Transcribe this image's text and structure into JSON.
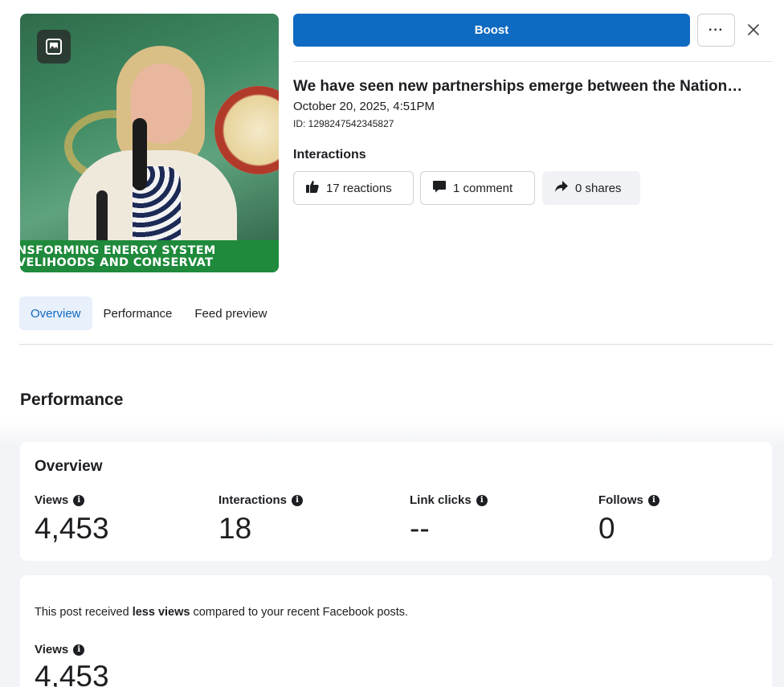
{
  "post": {
    "banner_line1": "NSFORMING ENERGY SYSTEM",
    "banner_line2": "VELIHOODS AND CONSERVAT",
    "title": "We have seen new partnerships emerge between the Nation…",
    "date": "October 20, 2025, 4:51PM",
    "id": "ID: 1298247542345827"
  },
  "toolbar": {
    "boost_label": "Boost",
    "more_label": "···"
  },
  "interactions": {
    "label": "Interactions",
    "reactions": "17 reactions",
    "comments": "1 comment",
    "shares": "0 shares"
  },
  "tabs": [
    {
      "label": "Overview",
      "active": true
    },
    {
      "label": "Performance",
      "active": false
    },
    {
      "label": "Feed preview",
      "active": false
    }
  ],
  "performance": {
    "title": "Performance",
    "overview": {
      "title": "Overview",
      "metrics": [
        {
          "label": "Views",
          "value": "4,453"
        },
        {
          "label": "Interactions",
          "value": "18"
        },
        {
          "label": "Link clicks",
          "value": "--"
        },
        {
          "label": "Follows",
          "value": "0"
        }
      ]
    },
    "comparison": {
      "text_before": "This post received ",
      "text_bold": "less views",
      "text_after": " compared to your recent Facebook posts.",
      "metric_label": "Views",
      "metric_value": "4,453"
    }
  },
  "colors": {
    "accent": "#0f6ac1",
    "tab_active_bg": "#e7f0fb",
    "banner_green": "#1f8a3b"
  },
  "icons": {
    "photo_badge": "photo-icon",
    "close": "close-icon",
    "reactions": "thumbs-up-icon",
    "comments": "comment-icon",
    "shares": "share-icon",
    "info": "info-icon"
  }
}
